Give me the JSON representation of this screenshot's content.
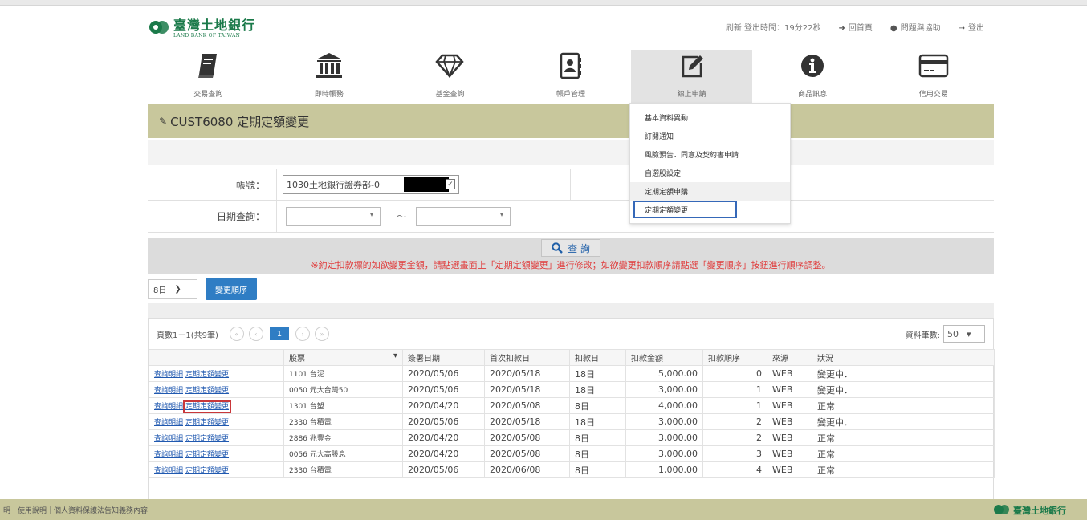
{
  "brand": {
    "name_cn": "臺灣土地銀行",
    "name_en": "LAND BANK OF TAIWAN"
  },
  "header": {
    "refresh": "刷新 登出時間：19分22秒",
    "home": "回首頁",
    "help": "問題與協助",
    "logout": "登出"
  },
  "nav": [
    {
      "label": "交易查詢",
      "icon": "book-icon"
    },
    {
      "label": "即時帳務",
      "icon": "bank-icon"
    },
    {
      "label": "基金查詢",
      "icon": "diamond-icon"
    },
    {
      "label": "帳戶管理",
      "icon": "contact-icon"
    },
    {
      "label": "線上申請",
      "icon": "edit-icon"
    },
    {
      "label": "商品訊息",
      "icon": "info-icon"
    },
    {
      "label": "信用交易",
      "icon": "credit-card-icon"
    }
  ],
  "menu": {
    "items": [
      "基本資料異動",
      "訂閱通知",
      "風險預告．同意及契約書申請",
      "自選股設定",
      "定期定額申購",
      "定期定額變更"
    ]
  },
  "page": {
    "title": "CUST6080 定期定額變更"
  },
  "form": {
    "account_label": "帳號：",
    "account_value": "1030土地銀行證券部-0",
    "date_label": "日期查詢：",
    "tilde": "～"
  },
  "query": {
    "button": "查 詢"
  },
  "notice": "※約定扣款標的如欲變更金額，請點選畫面上「定期定額變更」進行修改；如欲變更扣款順序請點選「變更順序」按鈕進行順序調整。",
  "controls": {
    "days": "8日",
    "order_button": "變更順序"
  },
  "pager": {
    "info": "頁數1－1(共9筆)",
    "current": "1",
    "rows_label": "資料筆數:",
    "rows_value": "50"
  },
  "table": {
    "headers": [
      "",
      "股票",
      "簽署日期",
      "首次扣款日",
      "扣款日",
      "扣款金額",
      "扣款順序",
      "來源",
      "狀況"
    ],
    "link1": "查詢明細",
    "link2": "定期定額變更",
    "rows": [
      {
        "stock": "1101 台泥",
        "sign": "2020/05/06",
        "first": "2020/05/18",
        "day": "18日",
        "amount": "5,000.00",
        "order": "0",
        "source": "WEB",
        "status": "變更中．"
      },
      {
        "stock": "0050 元大台灣50",
        "sign": "2020/05/06",
        "first": "2020/05/18",
        "day": "18日",
        "amount": "3,000.00",
        "order": "1",
        "source": "WEB",
        "status": "變更中．"
      },
      {
        "stock": "1301 台塑",
        "sign": "2020/04/20",
        "first": "2020/05/08",
        "day": "8日",
        "amount": "4,000.00",
        "order": "1",
        "source": "WEB",
        "status": "正常"
      },
      {
        "stock": "2330 台積電",
        "sign": "2020/05/06",
        "first": "2020/05/18",
        "day": "18日",
        "amount": "3,000.00",
        "order": "2",
        "source": "WEB",
        "status": "變更中．"
      },
      {
        "stock": "2886 兆豐金",
        "sign": "2020/04/20",
        "first": "2020/05/08",
        "day": "8日",
        "amount": "3,000.00",
        "order": "2",
        "source": "WEB",
        "status": "正常"
      },
      {
        "stock": "0056 元大高股息",
        "sign": "2020/04/20",
        "first": "2020/05/08",
        "day": "8日",
        "amount": "3,000.00",
        "order": "3",
        "source": "WEB",
        "status": "正常"
      },
      {
        "stock": "2330 台積電",
        "sign": "2020/05/06",
        "first": "2020/06/08",
        "day": "8日",
        "amount": "1,000.00",
        "order": "4",
        "source": "WEB",
        "status": "正常"
      }
    ]
  },
  "footer": "明｜使用說明｜個人資料保護法告知義務內容",
  "colors": {
    "accent": "#c8c79c",
    "link": "#2059b0",
    "notice": "#e03b3b",
    "button": "#2f7dc4"
  }
}
